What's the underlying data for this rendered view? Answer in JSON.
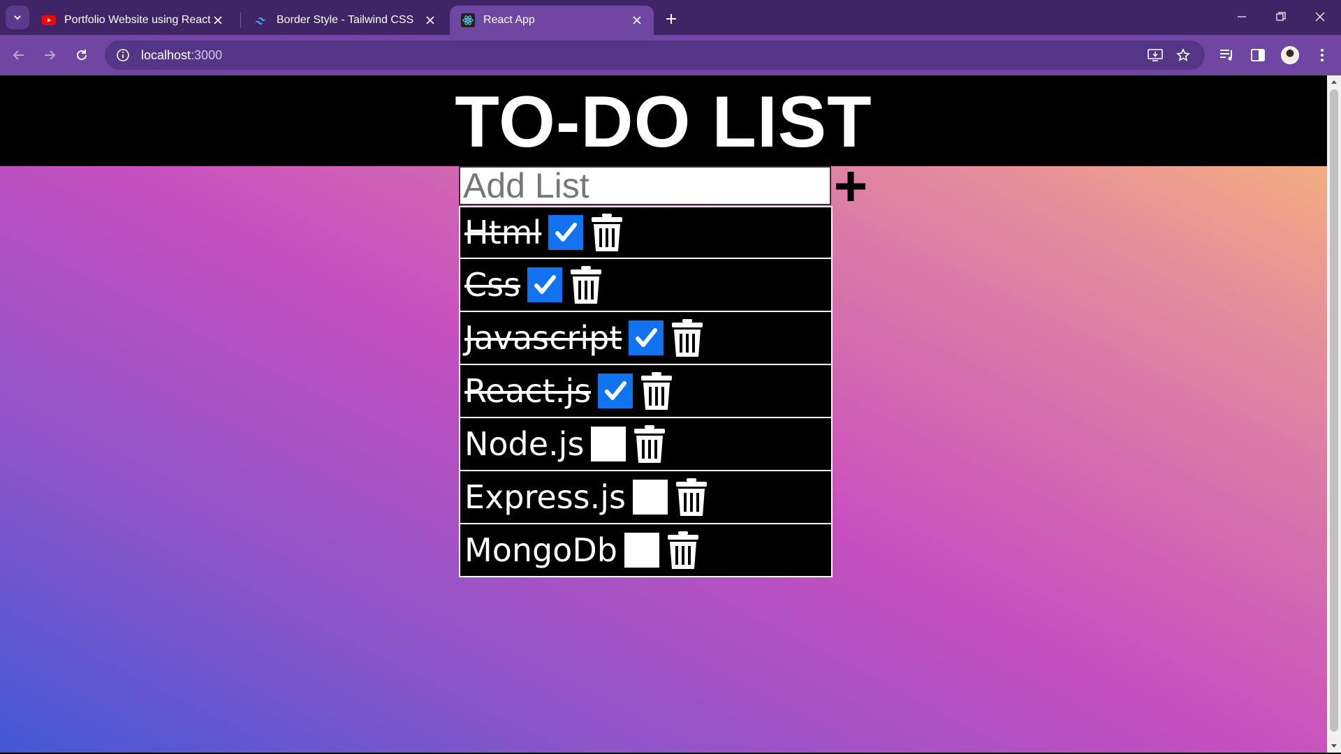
{
  "browser": {
    "tabs": [
      {
        "title": "Portfolio Website using React a",
        "favicon": "youtube-icon",
        "active": false
      },
      {
        "title": "Border Style - Tailwind CSS",
        "favicon": "tailwind-icon",
        "active": false
      },
      {
        "title": "React App",
        "favicon": "react-icon",
        "active": true
      }
    ],
    "address": {
      "host": "localhost",
      "port": ":3000"
    }
  },
  "app": {
    "title": "TO-DO LIST",
    "input": {
      "placeholder": "Add List",
      "value": ""
    },
    "todos": [
      {
        "text": "Html",
        "done": true
      },
      {
        "text": "Css",
        "done": true
      },
      {
        "text": "Javascript",
        "done": true
      },
      {
        "text": "React.js",
        "done": true
      },
      {
        "text": "Node.js",
        "done": false
      },
      {
        "text": "Express.js",
        "done": false
      },
      {
        "text": "MongoDb",
        "done": false
      }
    ]
  },
  "colors": {
    "checked": "#1173f0",
    "tab_strip": "#3f2466",
    "toolbar": "#6f47a3",
    "gradient": [
      "#4258d6",
      "#c74fbf",
      "#fbbd74"
    ]
  }
}
